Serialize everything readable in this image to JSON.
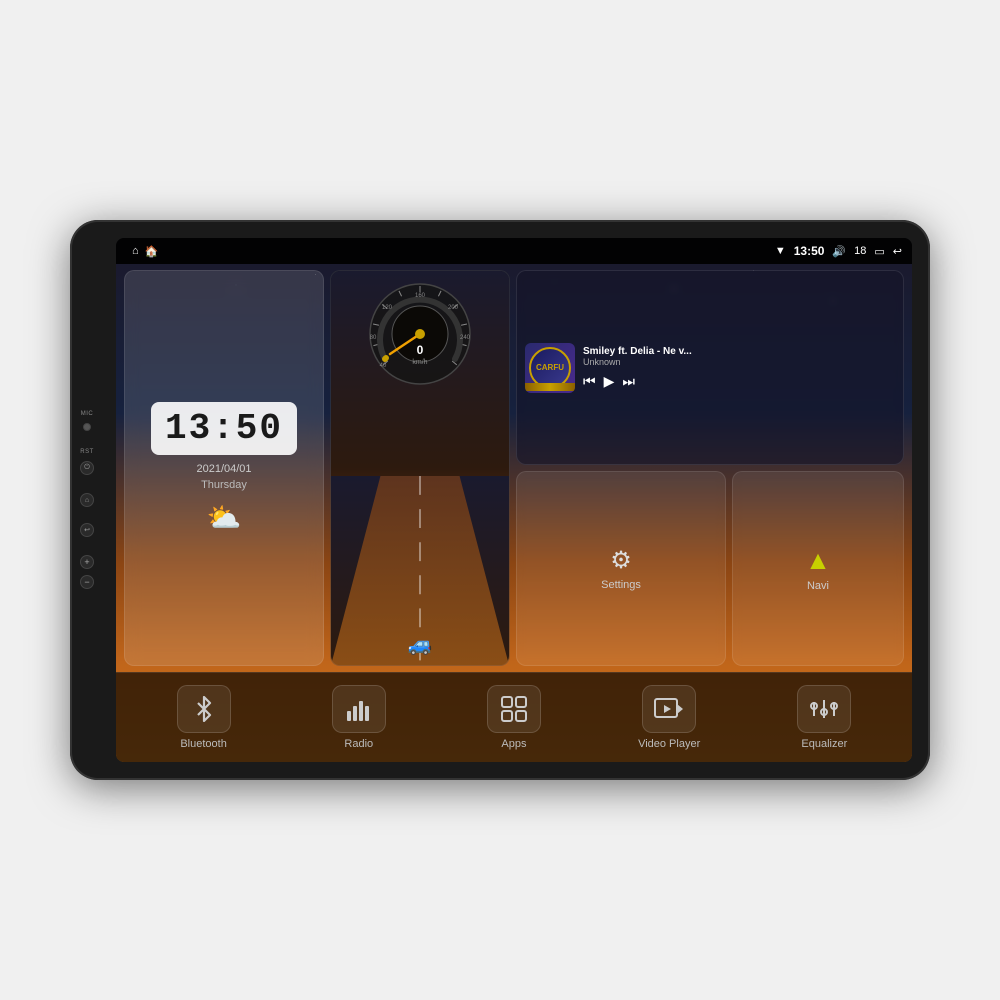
{
  "device": {
    "status_bar": {
      "wifi_icon": "▼",
      "time": "13:50",
      "volume_icon": "🔊",
      "volume_level": "18",
      "battery_icon": "🔋",
      "back_icon": "↩"
    },
    "side_buttons": [
      {
        "label": "MIC",
        "id": "mic"
      },
      {
        "label": "RST",
        "id": "rst"
      },
      {
        "label": "⌂",
        "id": "home"
      },
      {
        "label": "↩",
        "id": "back"
      },
      {
        "label": "V+",
        "id": "vol_up"
      },
      {
        "label": "V-",
        "id": "vol_down"
      }
    ],
    "clock_widget": {
      "time": "13:50",
      "date": "2021/04/01",
      "day": "Thursday",
      "weather_icon": "⛅"
    },
    "speedometer_widget": {
      "speed": "0",
      "unit": "km/h",
      "max": "240"
    },
    "music_widget": {
      "logo": "CARFU",
      "title": "Smiley ft. Delia - Ne v...",
      "artist": "Unknown",
      "prev_icon": "⏮",
      "play_icon": "▶",
      "next_icon": "⏭"
    },
    "settings_widget": {
      "icon": "⚙",
      "label": "Settings"
    },
    "navi_widget": {
      "icon": "⬆",
      "label": "Navi"
    },
    "bottom_items": [
      {
        "id": "bluetooth",
        "icon": "⚝",
        "label": "Bluetooth"
      },
      {
        "id": "radio",
        "icon": "📶",
        "label": "Radio"
      },
      {
        "id": "apps",
        "icon": "⊞",
        "label": "Apps"
      },
      {
        "id": "video_player",
        "icon": "📺",
        "label": "Video Player"
      },
      {
        "id": "equalizer",
        "icon": "🎛",
        "label": "Equalizer"
      }
    ]
  }
}
